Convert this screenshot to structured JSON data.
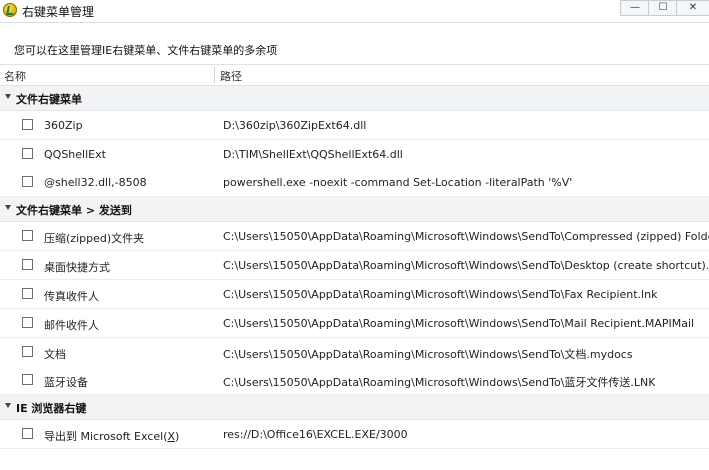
{
  "window": {
    "title": "右键菜单管理",
    "minimize": "—",
    "maximize": "☐",
    "close": "✕"
  },
  "description": "您可以在这里管理IE右键菜单、文件右键菜单的多余项",
  "columns": {
    "name": "名称",
    "path": "路径"
  },
  "groups": [
    {
      "label": "文件右键菜单",
      "items": [
        {
          "name": "360Zip",
          "path": "D:\\360zip\\360ZipExt64.dll"
        },
        {
          "name": "QQShellExt",
          "path": "D:\\TIM\\ShellExt\\QQShellExt64.dll"
        },
        {
          "name": "@shell32.dll,-8508",
          "path": "powershell.exe -noexit -command Set-Location -literalPath '%V'"
        }
      ]
    },
    {
      "label": "文件右键菜单 > 发送到",
      "items": [
        {
          "name": "压缩(zipped)文件夹",
          "path": "C:\\Users\\15050\\AppData\\Roaming\\Microsoft\\Windows\\SendTo\\Compressed (zipped) Folder"
        },
        {
          "name": "桌面快捷方式",
          "path": "C:\\Users\\15050\\AppData\\Roaming\\Microsoft\\Windows\\SendTo\\Desktop (create shortcut).De"
        },
        {
          "name": "传真收件人",
          "path": "C:\\Users\\15050\\AppData\\Roaming\\Microsoft\\Windows\\SendTo\\Fax Recipient.lnk"
        },
        {
          "name": "邮件收件人",
          "path": "C:\\Users\\15050\\AppData\\Roaming\\Microsoft\\Windows\\SendTo\\Mail Recipient.MAPIMail"
        },
        {
          "name": "文档",
          "path": "C:\\Users\\15050\\AppData\\Roaming\\Microsoft\\Windows\\SendTo\\文档.mydocs"
        },
        {
          "name": "蓝牙设备",
          "path": "C:\\Users\\15050\\AppData\\Roaming\\Microsoft\\Windows\\SendTo\\蓝牙文件传送.LNK"
        }
      ]
    },
    {
      "label": "IE 浏览器右键",
      "items": [
        {
          "name_prefix": "导出到 Microsoft Excel(",
          "name_mnemonic": "X",
          "name_suffix": ")",
          "path": "res://D:\\Office16\\EXCEL.EXE/3000"
        }
      ]
    }
  ],
  "icons": {
    "app": "shield-check-icon",
    "collapse": "triangle-down-icon"
  }
}
